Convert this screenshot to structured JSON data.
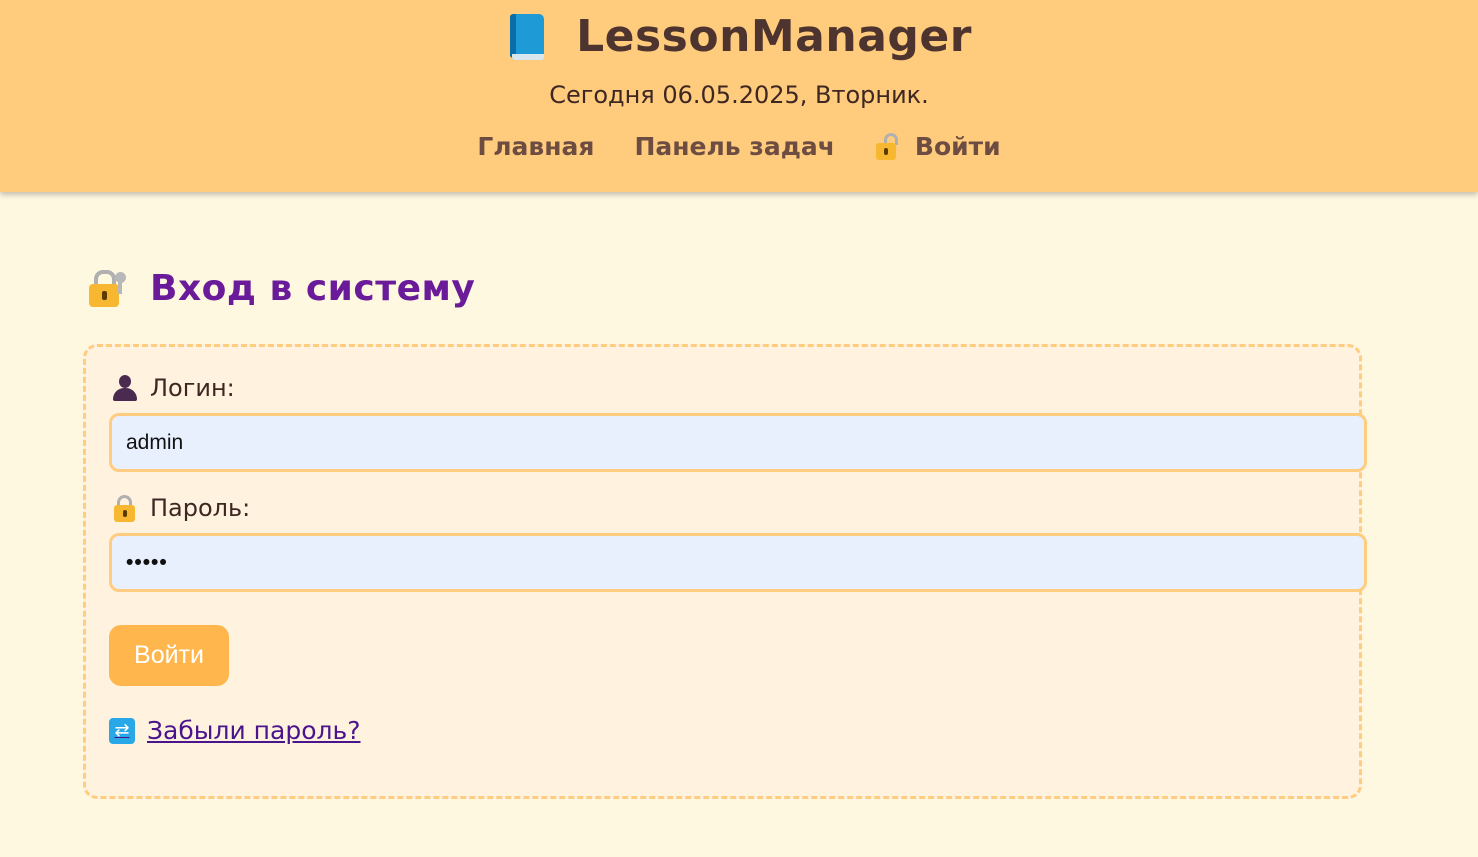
{
  "header": {
    "brand_icon": "book-icon",
    "title": "LessonManager",
    "today_text": "Сегодня 06.05.2025, Вторник.",
    "nav": {
      "home": "Главная",
      "tasks": "Панель задач",
      "login": "Войти",
      "login_icon": "unlock-icon"
    },
    "background": "#ffcb7d"
  },
  "login": {
    "heading": "Вход в систему",
    "heading_icon": "lock-with-key-icon",
    "username_label": "Логин:",
    "username_icon": "user-icon",
    "username_value": "admin",
    "password_label": "Пароль:",
    "password_icon": "lock-icon",
    "password_value": "•••••",
    "submit_label": "Войти",
    "forgot_label": "Забыли пароль?",
    "forgot_icon": "repeat-icon"
  },
  "colors": {
    "heading": "#6a1b9a",
    "button": "#ffb74d",
    "input_bg": "#e8f0fe",
    "border": "#ffcc80",
    "page_bg": "#fff8e1"
  }
}
